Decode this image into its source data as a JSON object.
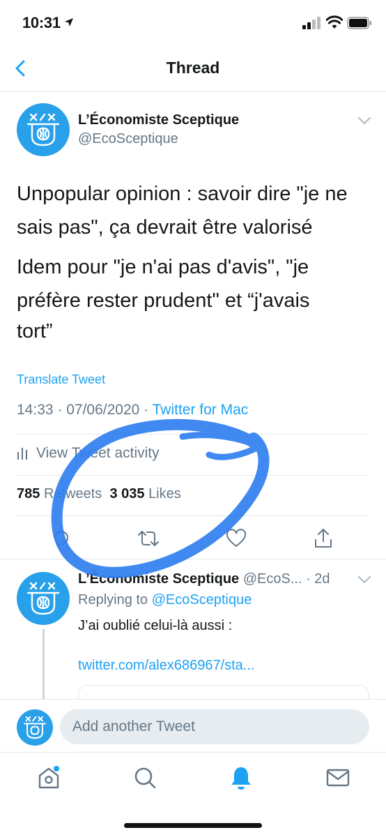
{
  "status_bar": {
    "time": "10:31",
    "icons": [
      "location-arrow-icon",
      "cellular-signal-icon",
      "wifi-icon",
      "battery-icon"
    ]
  },
  "nav": {
    "title": "Thread",
    "back_icon": "chevron-left-icon"
  },
  "tweet": {
    "author_name": "L’Économiste Sceptique",
    "author_handle": "@EcoSceptique",
    "text_lines": [
      "Unpopular opinion : savoir dire \"je ne",
      "sais pas\", ça devrait être valorisé",
      "Idem pour \"je n'ai pas d'avis\", \"je",
      "préfère rester prudent\" et “j'avais",
      "tort”"
    ],
    "translate_label": "Translate Tweet",
    "timestamp": "14:33 · 07/06/2020 · ",
    "source": "Twitter for Mac",
    "activity_label": "View Tweet activity",
    "retweets_count": "785",
    "retweets_label": "Retweets",
    "likes_count": "3 035",
    "likes_label": "Likes",
    "actions": [
      "reply-icon",
      "retweet-icon",
      "like-icon",
      "share-icon"
    ]
  },
  "reply": {
    "author_name": "L’Économiste Sceptique",
    "author_handle": "@EcoS...",
    "time_ago": "· 2d",
    "replying_to_label": "Replying to ",
    "replying_to_handle": "@EcoSceptique",
    "text": "J’ai oublié celui-là aussi :",
    "link": "twitter.com/alex686967/sta..."
  },
  "composer": {
    "placeholder": "Add another Tweet"
  },
  "tab_bar": {
    "tabs": [
      "home-icon",
      "search-icon",
      "notifications-icon",
      "messages-icon"
    ],
    "active_tab": "notifications-icon"
  },
  "colors": {
    "accent": "#1da1f2",
    "avatar_bg": "#29a0ea",
    "secondary_text": "#657786",
    "annotation_ink": "#2f7ff0"
  }
}
